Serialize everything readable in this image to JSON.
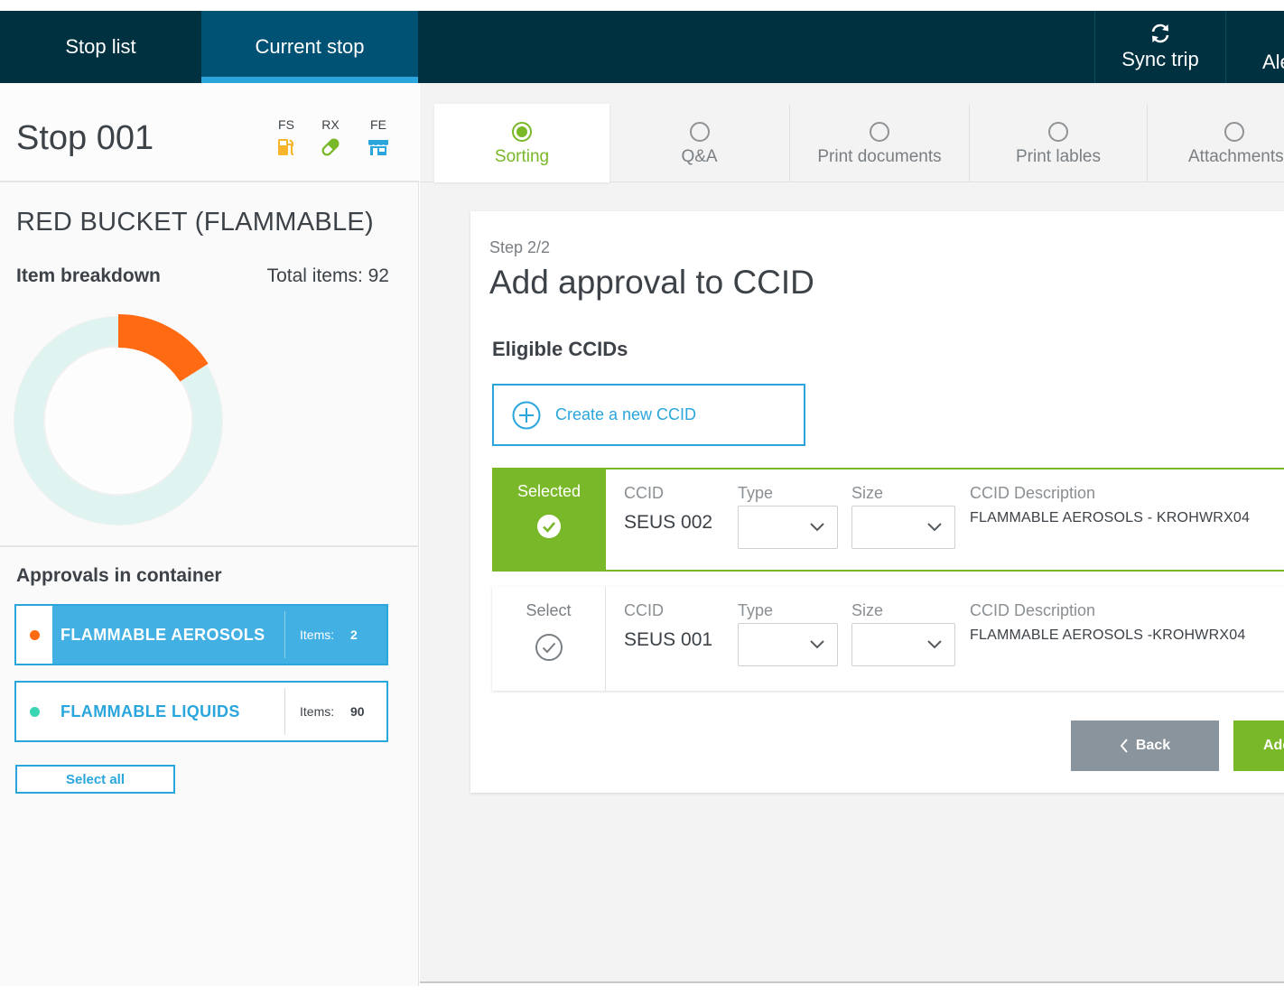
{
  "topbar": {
    "tabs": [
      {
        "label": "Stop list"
      },
      {
        "label": "Current stop"
      }
    ],
    "sync_label": "Sync trip",
    "alert_label": "Ale"
  },
  "stop": {
    "title": "Stop 001",
    "badges": [
      {
        "code": "FS",
        "icon": "fuel-pump-icon",
        "color": "#f7b52c"
      },
      {
        "code": "RX",
        "icon": "pill-icon",
        "color": "#79b829"
      },
      {
        "code": "FE",
        "icon": "storefront-icon",
        "color": "#2aa6dc"
      }
    ]
  },
  "container": {
    "name": "RED BUCKET (FLAMMABLE)",
    "breakdown_label": "Item breakdown",
    "total_label": "Total items: 92",
    "donut": {
      "total": 92,
      "highlighted": 2,
      "highlight_color": "#ff6a13",
      "base_color": "#dff3f0"
    },
    "approvals_title": "Approvals in container",
    "approvals": [
      {
        "name": "FLAMMABLE AEROSOLS",
        "items_label": "Items:",
        "count": "2",
        "dot_color": "#ff6a13",
        "active": true
      },
      {
        "name": "FLAMMABLE LIQUIDS",
        "items_label": "Items:",
        "count": "90",
        "dot_color": "#3bd5b3",
        "active": false
      }
    ],
    "select_all_label": "Select all"
  },
  "steps": [
    {
      "label": "Sorting",
      "active": true
    },
    {
      "label": "Q&A",
      "active": false
    },
    {
      "label": "Print documents",
      "active": false
    },
    {
      "label": "Print lables",
      "active": false
    },
    {
      "label": "Attachments",
      "active": false
    }
  ],
  "card": {
    "step_label": "Step 2/2",
    "title": "Add approval to CCID",
    "eligible_label": "Eligible CCIDs",
    "create_label": "Create a new CCID",
    "columns": {
      "ccid": "CCID",
      "type": "Type",
      "size": "Size",
      "description": "CCID Description"
    },
    "rows": [
      {
        "state_label": "Selected",
        "selected": true,
        "ccid": "SEUS 002",
        "description": "FLAMMABLE AEROSOLS - KROHWRX04"
      },
      {
        "state_label": "Select",
        "selected": false,
        "ccid": "SEUS 001",
        "description": "FLAMMABLE AEROSOLS  -KROHWRX04"
      }
    ],
    "back_label": "Back",
    "add_label": "Add"
  },
  "colors": {
    "topbar": "#003141",
    "active_tab": "#005274",
    "accent_blue": "#2aa6dc",
    "accent_green": "#79b829"
  }
}
